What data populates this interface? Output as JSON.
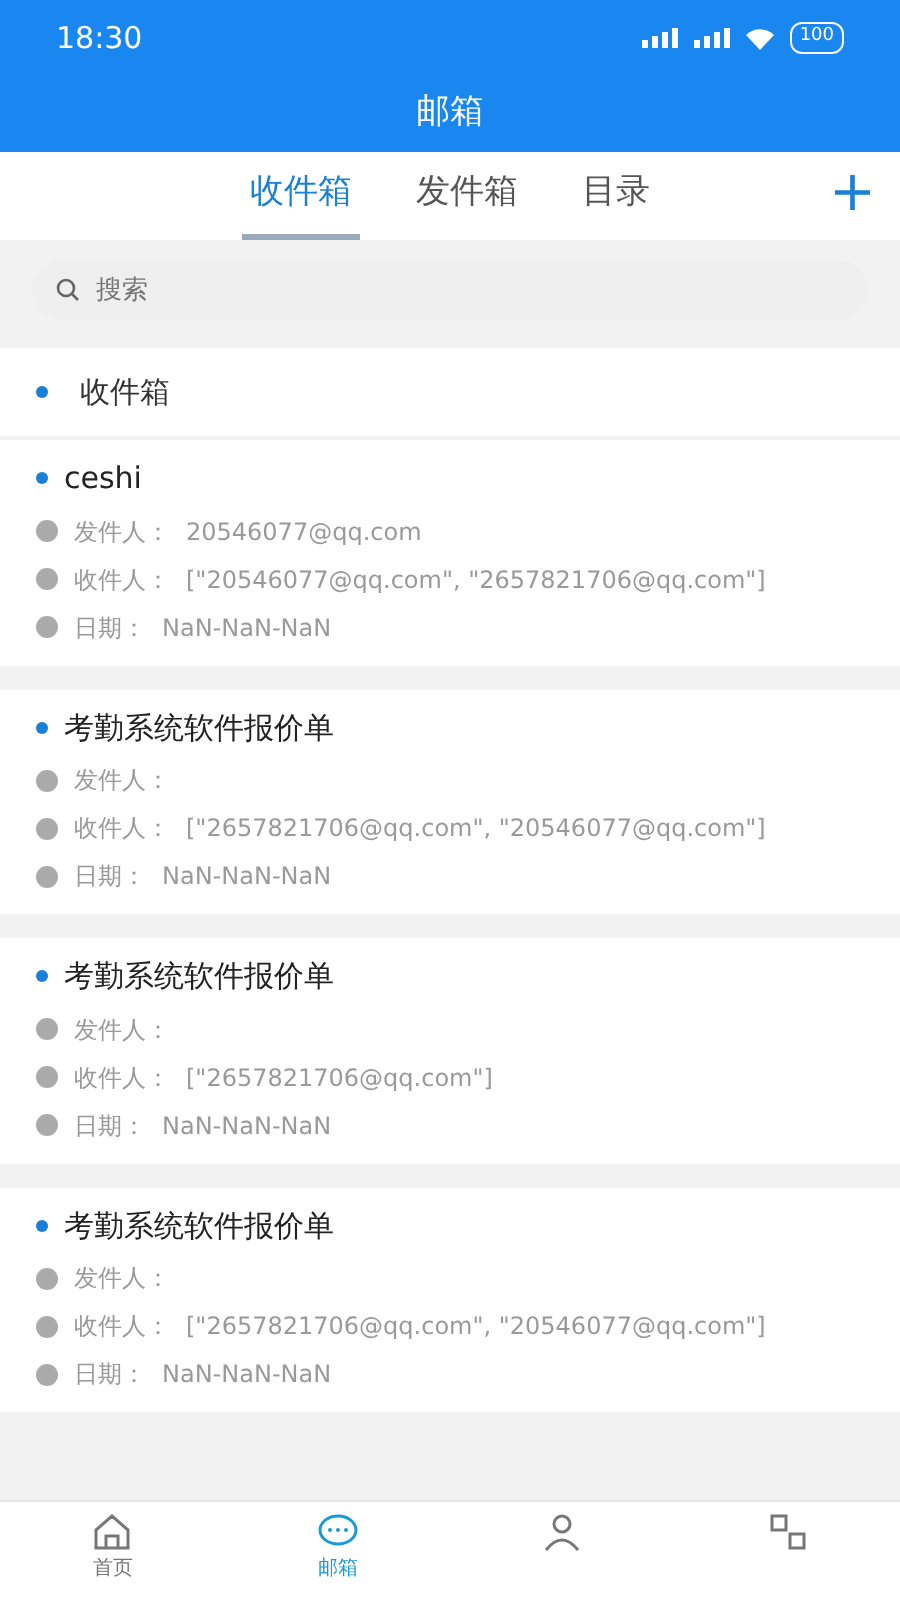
{
  "status_bar": {
    "time": "18:30",
    "battery": "100"
  },
  "title": "邮箱",
  "tabs": [
    {
      "label": "收件箱",
      "selected": true
    },
    {
      "label": "发件箱",
      "selected": false
    },
    {
      "label": "目录",
      "selected": false
    }
  ],
  "add_button": "+",
  "search": {
    "placeholder": "搜索"
  },
  "section": "收件箱",
  "mails": [
    {
      "subject": "ceshi",
      "fields": [
        {
          "label": "发件人：",
          "value": "20546077@qq.com"
        },
        {
          "label": "收件人：",
          "value": "[\"20546077@qq.com\", \"2657821706@qq.com\"]"
        },
        {
          "label": "日期：",
          "value": "NaN-NaN-NaN"
        }
      ]
    },
    {
      "subject": "考勤系统软件报价单",
      "fields": [
        {
          "label": "发件人："
        },
        {
          "label": "收件人：",
          "value": "[\"2657821706@qq.com\", \"20546077@qq.com\"]"
        },
        {
          "label": "日期：",
          "value": "NaN-NaN-NaN"
        }
      ]
    },
    {
      "subject": "考勤系统软件报价单",
      "fields": [
        {
          "label": "发件人："
        },
        {
          "label": "收件人：",
          "value": "[\"2657821706@qq.com\"]"
        },
        {
          "label": "日期：",
          "value": "NaN-NaN-NaN"
        }
      ]
    },
    {
      "subject": "考勤系统软件报价单",
      "fields": [
        {
          "label": "发件人："
        },
        {
          "label": "收件人：",
          "value": "[\"2657821706@qq.com\", \"20546077@qq.com\"]"
        },
        {
          "label": "日期：",
          "value": "NaN-NaN-NaN"
        }
      ]
    }
  ],
  "bottom_nav": [
    {
      "kind": "home",
      "label": "首页",
      "selected": false
    },
    {
      "kind": "chat",
      "label": "邮箱",
      "selected": true
    },
    {
      "kind": "person",
      "selected": false
    },
    {
      "kind": "grid",
      "selected": false
    }
  ]
}
